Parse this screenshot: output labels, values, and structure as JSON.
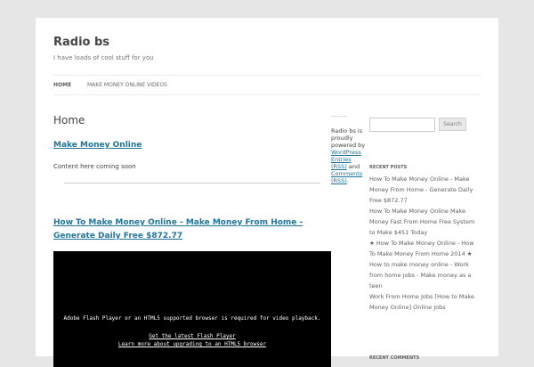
{
  "site": {
    "title": "Radio bs",
    "description": "I have loads of cool stuff for you"
  },
  "nav": {
    "items": [
      {
        "label": "HOME"
      },
      {
        "label": "MAKE MONEY ONLINE VIDEOS"
      }
    ]
  },
  "main": {
    "page_title": "Home",
    "post1_title": "Make Money Online",
    "post1_body": "Content here coming soon",
    "post2_title": "How To Make Money Online - Make Money From Home - Generate Daily Free $872.77",
    "video": {
      "message": "Adobe Flash Player or an HTML5 supported browser is required for video playback.",
      "link1": "Get the latest Flash Player",
      "link2": "Learn more about upgrading to an HTML5 browser"
    }
  },
  "mid": {
    "text1": "Radio bs is proudly powered by",
    "link_entries": "WordPress Entries (RSS)",
    "text2": "and",
    "link_comments": "Comments (RSS)",
    "text3": "."
  },
  "sidebar": {
    "search_button": "Search",
    "recent_posts_title": "RECENT POSTS",
    "recent_posts": [
      "How To Make Money Online - Make Money From Home - Generate Daily Free $872.77",
      "How To Make Money Online Make Money Fast From Home Free System to Make $451 Today",
      "★ How To Make Money Online - How To Make Money From Home 2014 ★",
      "How to make money online - Work from home jobs - Make money as a teen",
      "Work From Home Jobs [How to Make Money Online] Online Jobs"
    ],
    "recent_comments_title": "RECENT COMMENTS"
  }
}
